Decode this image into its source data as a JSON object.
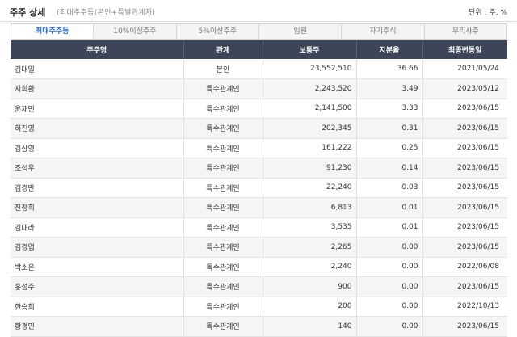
{
  "header": {
    "title": "주주 상세",
    "subtitle": "(최대주주등(본인+특별관계자)",
    "unit": "단위 : 주, %"
  },
  "tabs": [
    {
      "label": "최대주주등",
      "active": true
    },
    {
      "label": "10%이상주주",
      "active": false
    },
    {
      "label": "5%이상주주",
      "active": false
    },
    {
      "label": "임원",
      "active": false
    },
    {
      "label": "자기주식",
      "active": false
    },
    {
      "label": "우리사주",
      "active": false
    }
  ],
  "table": {
    "columns": [
      "주주명",
      "관계",
      "보통주",
      "지분율",
      "최종변동일"
    ],
    "rows": [
      {
        "name": "김대일",
        "relation": "본인",
        "shares": "23,552,510",
        "ratio": "36.66",
        "date": "2021/05/24"
      },
      {
        "name": "지희환",
        "relation": "특수관계인",
        "shares": "2,243,520",
        "ratio": "3.49",
        "date": "2023/05/12"
      },
      {
        "name": "윤재민",
        "relation": "특수관계인",
        "shares": "2,141,500",
        "ratio": "3.33",
        "date": "2023/06/15"
      },
      {
        "name": "허진영",
        "relation": "특수관계인",
        "shares": "202,345",
        "ratio": "0.31",
        "date": "2023/06/15"
      },
      {
        "name": "김상영",
        "relation": "특수관계인",
        "shares": "161,222",
        "ratio": "0.25",
        "date": "2023/06/15"
      },
      {
        "name": "조석우",
        "relation": "특수관계인",
        "shares": "91,230",
        "ratio": "0.14",
        "date": "2023/06/15"
      },
      {
        "name": "김경만",
        "relation": "특수관계인",
        "shares": "22,240",
        "ratio": "0.03",
        "date": "2023/06/15"
      },
      {
        "name": "진정희",
        "relation": "특수관계인",
        "shares": "6,813",
        "ratio": "0.01",
        "date": "2023/06/15"
      },
      {
        "name": "김대라",
        "relation": "특수관계인",
        "shares": "3,535",
        "ratio": "0.01",
        "date": "2023/06/15"
      },
      {
        "name": "김경업",
        "relation": "특수관계인",
        "shares": "2,265",
        "ratio": "0.00",
        "date": "2023/06/15"
      },
      {
        "name": "박소은",
        "relation": "특수관계인",
        "shares": "2,240",
        "ratio": "0.00",
        "date": "2022/06/08"
      },
      {
        "name": "홍성주",
        "relation": "특수관계인",
        "shares": "900",
        "ratio": "0.00",
        "date": "2023/06/15"
      },
      {
        "name": "한승희",
        "relation": "특수관계인",
        "shares": "200",
        "ratio": "0.00",
        "date": "2022/10/13"
      },
      {
        "name": "황경민",
        "relation": "특수관계인",
        "shares": "140",
        "ratio": "0.00",
        "date": "2023/06/15"
      }
    ]
  }
}
